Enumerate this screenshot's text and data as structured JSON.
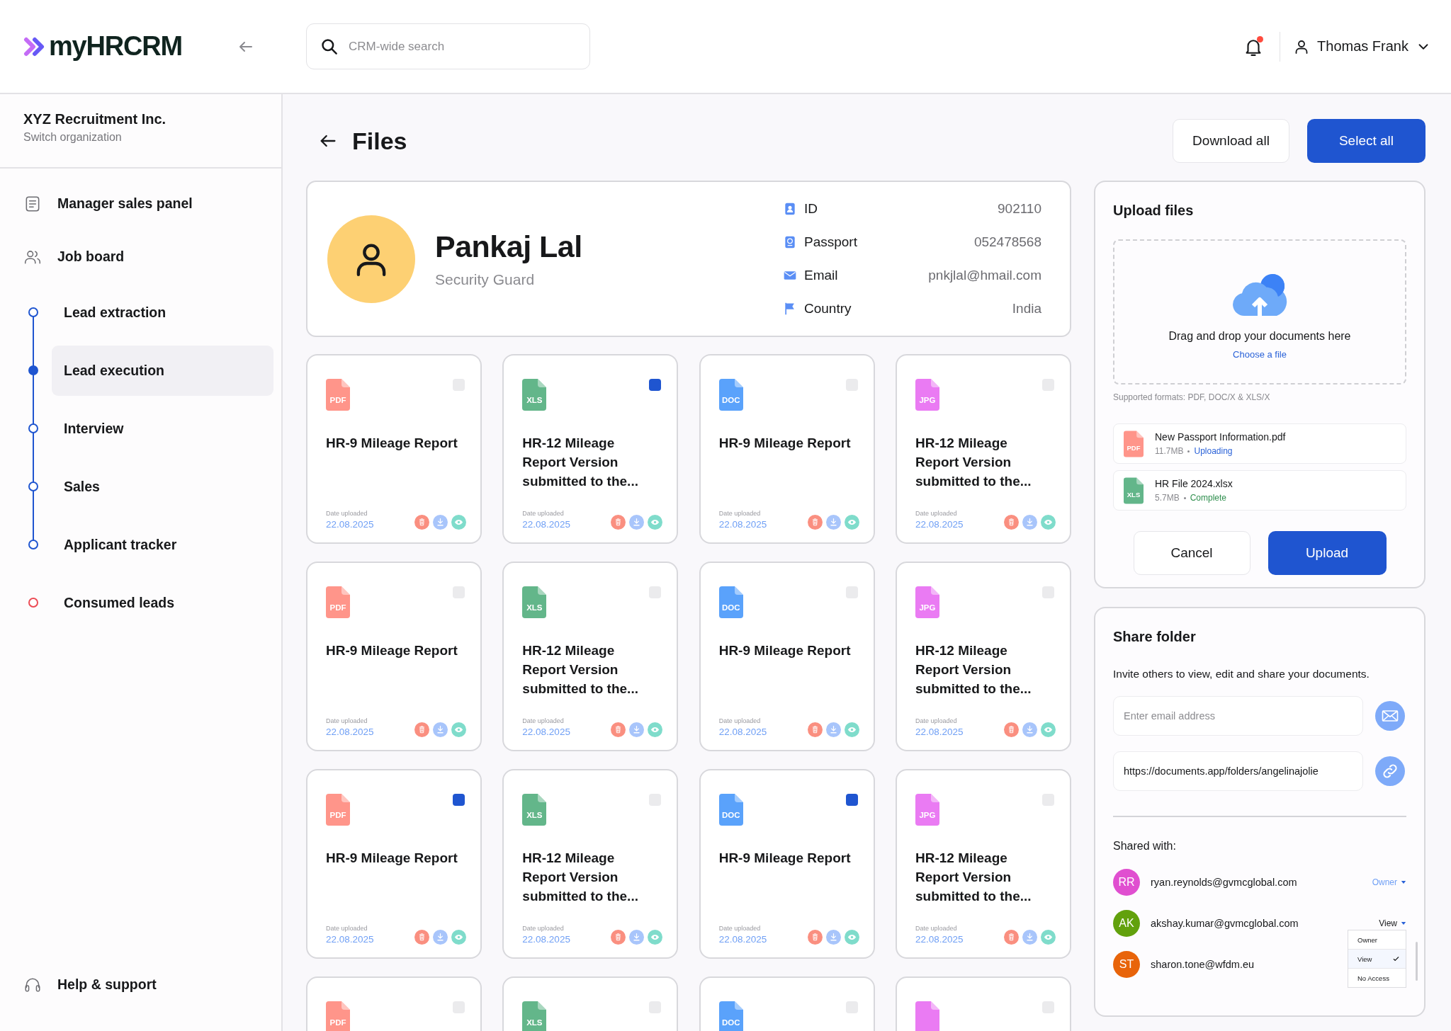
{
  "header": {
    "logo": "myHRCRM",
    "search": {
      "placeholder": "CRM-wide search"
    },
    "notifications": {
      "unread": true
    },
    "user": {
      "name": "Thomas Frank"
    }
  },
  "sidebar": {
    "organization": {
      "name": "XYZ Recruitment Inc.",
      "action": "Switch organization"
    },
    "items": [
      {
        "label": "Manager sales panel",
        "kind": "report",
        "selected": false
      },
      {
        "label": "Job board",
        "kind": "team",
        "selected": false
      },
      {
        "label": "Lead extraction",
        "kind": "stage",
        "selected": false
      },
      {
        "label": "Lead execution",
        "kind": "stage",
        "selected": true
      },
      {
        "label": "Interview",
        "kind": "stage",
        "selected": false
      },
      {
        "label": "Sales",
        "kind": "stage",
        "selected": false
      },
      {
        "label": "Applicant tracker",
        "kind": "stage",
        "selected": false
      },
      {
        "label": "Consumed leads",
        "kind": "alert",
        "selected": false
      }
    ],
    "help": {
      "label": "Help & support"
    }
  },
  "page": {
    "title": "Files",
    "actions": [
      {
        "label": "Download all",
        "kind": "secondary"
      },
      {
        "label": "Select all",
        "kind": "primary"
      }
    ],
    "profile": {
      "name": "Pankaj Lal",
      "role": "Security Guard",
      "fields": [
        {
          "kind": "id",
          "label": "ID",
          "value": "902110"
        },
        {
          "kind": "passport",
          "label": "Passport",
          "value": "052478568"
        },
        {
          "kind": "email",
          "label": "Email",
          "value": "pnkjlal@hmail.com"
        },
        {
          "kind": "country",
          "label": "Country",
          "value": "India"
        }
      ]
    },
    "files": [
      {
        "kind": "pdf",
        "badge": "PDF",
        "title": "HR-9 Mileage Report",
        "date_label": "Date uploaded",
        "date": "22.08.2025",
        "selected": false
      },
      {
        "kind": "xls",
        "badge": "XLS",
        "title": "HR-12 Mileage Report Version submitted to the...",
        "date_label": "Date uploaded",
        "date": "22.08.2025",
        "selected": true
      },
      {
        "kind": "doc",
        "badge": "DOC",
        "title": "HR-9 Mileage Report",
        "date_label": "Date uploaded",
        "date": "22.08.2025",
        "selected": false
      },
      {
        "kind": "jpg",
        "badge": "JPG",
        "title": "HR-12 Mileage Report Version submitted to the...",
        "date_label": "Date uploaded",
        "date": "22.08.2025",
        "selected": false
      },
      {
        "kind": "pdf",
        "badge": "PDF",
        "title": "HR-9 Mileage Report",
        "date_label": "Date uploaded",
        "date": "22.08.2025",
        "selected": false
      },
      {
        "kind": "xls",
        "badge": "XLS",
        "title": "HR-12 Mileage Report Version submitted to the...",
        "date_label": "Date uploaded",
        "date": "22.08.2025",
        "selected": false
      },
      {
        "kind": "doc",
        "badge": "DOC",
        "title": "HR-9 Mileage Report",
        "date_label": "Date uploaded",
        "date": "22.08.2025",
        "selected": false
      },
      {
        "kind": "jpg",
        "badge": "JPG",
        "title": "HR-12 Mileage Report Version submitted to the...",
        "date_label": "Date uploaded",
        "date": "22.08.2025",
        "selected": false
      },
      {
        "kind": "pdf",
        "badge": "PDF",
        "title": "HR-9 Mileage Report",
        "date_label": "Date uploaded",
        "date": "22.08.2025",
        "selected": true
      },
      {
        "kind": "xls",
        "badge": "XLS",
        "title": "HR-12 Mileage Report Version submitted to the...",
        "date_label": "Date uploaded",
        "date": "22.08.2025",
        "selected": false
      },
      {
        "kind": "doc",
        "badge": "DOC",
        "title": "HR-9 Mileage Report",
        "date_label": "Date uploaded",
        "date": "22.08.2025",
        "selected": true
      },
      {
        "kind": "jpg",
        "badge": "JPG",
        "title": "HR-12 Mileage Report Version submitted to the...",
        "date_label": "Date uploaded",
        "date": "22.08.2025",
        "selected": false
      },
      {
        "kind": "pdf",
        "badge": "PDF",
        "selected": false
      },
      {
        "kind": "xls",
        "badge": "XLS",
        "selected": false
      },
      {
        "kind": "doc",
        "badge": "DOC",
        "selected": false
      },
      {
        "kind": "jpg",
        "selected": false
      }
    ]
  },
  "upload": {
    "title": "Upload files",
    "dropzone": {
      "text": "Drag and drop your documents here",
      "link": "Choose a file"
    },
    "hint": "Supported formats: PDF, DOC/X & XLS/X",
    "items": [
      {
        "file": {
          "kind": "pdf",
          "badge": "PDF"
        },
        "name": "New Passport Information.pdf",
        "size": "11.7MB",
        "status": {
          "kind": "uploading",
          "text": "Uploading"
        }
      },
      {
        "file": {
          "kind": "xls",
          "badge": "XLS"
        },
        "name": "HR File 2024.xlsx",
        "size": "5.7MB",
        "status": {
          "kind": "complete",
          "text": "Complete"
        }
      }
    ],
    "buttons": [
      {
        "label": "Cancel",
        "kind": "secondary"
      },
      {
        "label": "Upload",
        "kind": "primary"
      }
    ]
  },
  "share": {
    "title": "Share folder",
    "description": "Invite others to view, edit and share your documents.",
    "email": {
      "placeholder": "Enter email address"
    },
    "link": {
      "value": "https://documents.app/folders/angelinajolie"
    },
    "shared_label": "Shared with:",
    "people": [
      {
        "initials": "RR",
        "email": "ryan.reynolds@gvmcglobal.com",
        "color": "#e04fd0",
        "role": "Owner",
        "kind": "owner"
      },
      {
        "initials": "AK",
        "email": "akshay.kumar@gvmcglobal.com",
        "color": "#62a10d",
        "role": "View",
        "kind": "member",
        "menu": {
          "options": [
            {
              "label": "Owner",
              "selected": false
            },
            {
              "label": "View",
              "selected": true
            },
            {
              "label": "No Access",
              "selected": false
            }
          ]
        }
      },
      {
        "initials": "ST",
        "email": "sharon.tone@wfdm.eu",
        "color": "#e8640a"
      }
    ]
  }
}
